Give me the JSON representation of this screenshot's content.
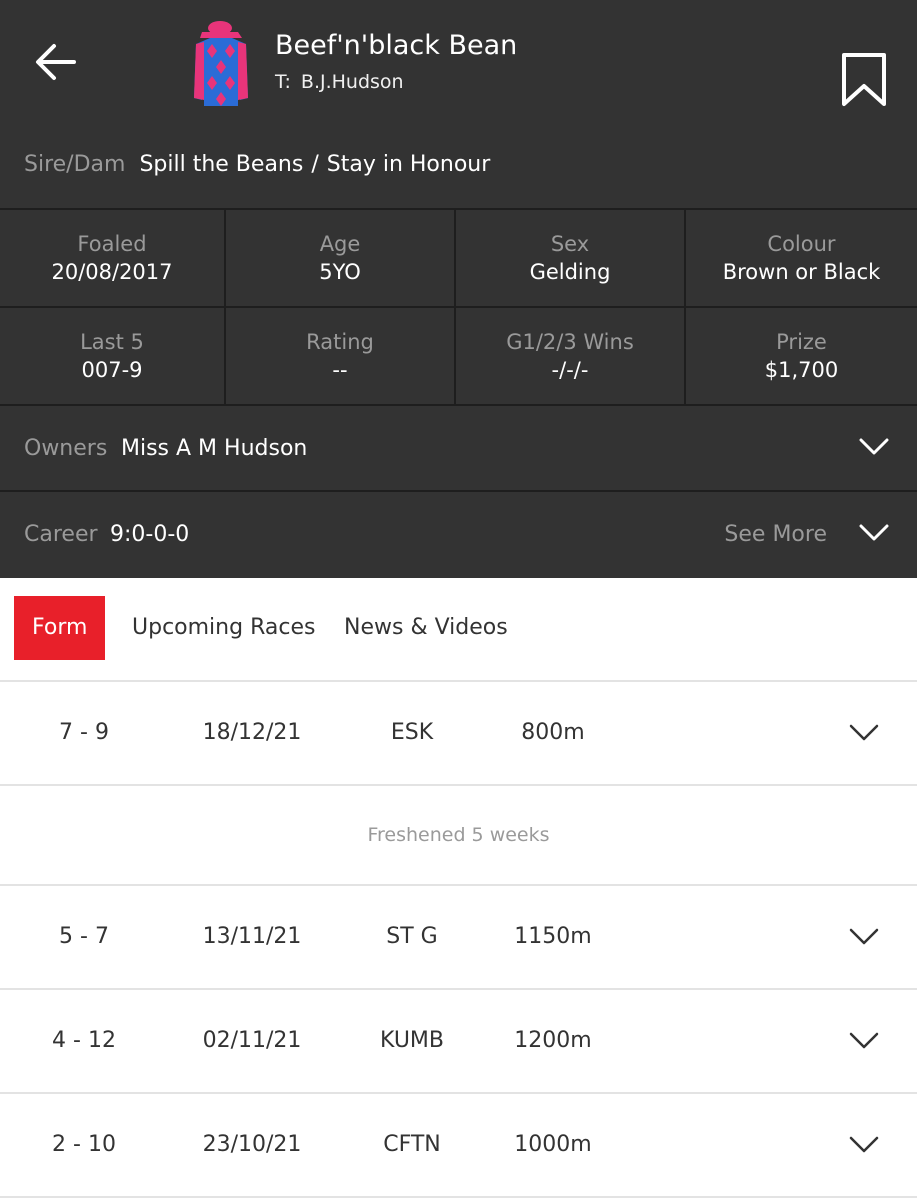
{
  "horse": {
    "name": "Beef'n'black Bean",
    "trainer_label": "T:",
    "trainer": "B.J.Hudson",
    "silks_colors": {
      "body": "#2b6cd6",
      "diamonds": "#e8347a",
      "sleeves": "#e8347a",
      "cap": "#e8347a"
    }
  },
  "pedigree": {
    "label": "Sire/Dam",
    "sire": "Spill the Beans",
    "separator": "/",
    "dam": "Stay in Honour"
  },
  "stats": [
    {
      "label": "Foaled",
      "value": "20/08/2017"
    },
    {
      "label": "Age",
      "value": "5YO"
    },
    {
      "label": "Sex",
      "value": "Gelding"
    },
    {
      "label": "Colour",
      "value": "Brown or Black"
    },
    {
      "label": "Last 5",
      "value": "007-9"
    },
    {
      "label": "Rating",
      "value": "--"
    },
    {
      "label": "G1/2/3 Wins",
      "value": "-/-/-"
    },
    {
      "label": "Prize",
      "value": "$1,700"
    }
  ],
  "owners": {
    "label": "Owners",
    "value": "Miss A M Hudson"
  },
  "career": {
    "label": "Career",
    "value": "9:0-0-0",
    "see_more": "See More"
  },
  "tabs": [
    {
      "label": "Form",
      "active": true
    },
    {
      "label": "Upcoming Races",
      "active": false
    },
    {
      "label": "News & Videos",
      "active": false
    }
  ],
  "form": [
    {
      "position": "7 - 9",
      "date": "18/12/21",
      "track": "ESK",
      "distance": "800m"
    },
    {
      "position": "5 - 7",
      "date": "13/11/21",
      "track": "ST G",
      "distance": "1150m"
    },
    {
      "position": "4 - 12",
      "date": "02/11/21",
      "track": "KUMB",
      "distance": "1200m"
    },
    {
      "position": "2 - 10",
      "date": "23/10/21",
      "track": "CFTN",
      "distance": "1000m"
    }
  ],
  "freshened_note": "Freshened 5 weeks",
  "colors": {
    "dark_bg": "#333333",
    "accent": "#e8202a",
    "muted": "#9a9a9a"
  },
  "icons": [
    "arrow-left-icon",
    "bookmark-icon",
    "chevron-down-icon",
    "jockey-silks-icon"
  ]
}
